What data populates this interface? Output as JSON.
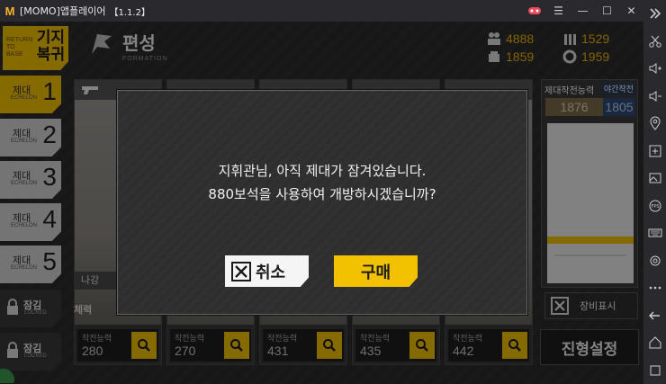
{
  "window": {
    "title": "[MOMO]앱플레이어",
    "version": "【1.1.2】",
    "controls": [
      "gamepad-icon",
      "menu-icon",
      "minimize-icon",
      "maximize-icon",
      "close-icon"
    ]
  },
  "header": {
    "back_en": "RETURN TO BASE",
    "back_ko": "기지 복귀",
    "title_ko": "편성",
    "title_en": "FORMATION"
  },
  "resources": {
    "manpower": "4888",
    "ammo": "1529",
    "rations": "1859",
    "parts": "1959"
  },
  "echelons": [
    {
      "ko": "제대",
      "en": "ECHELON",
      "num": "1"
    },
    {
      "ko": "제대",
      "en": "ECHELON",
      "num": "2"
    },
    {
      "ko": "제대",
      "en": "ECHELON",
      "num": "3"
    },
    {
      "ko": "제대",
      "en": "ECHELON",
      "num": "4"
    },
    {
      "ko": "제대",
      "en": "ECHELON",
      "num": "5"
    },
    {
      "ko": "잠김",
      "en": "LOCKED"
    },
    {
      "ko": "잠김",
      "en": "LOCKED"
    }
  ],
  "slots": [
    {
      "label": "작전능력",
      "value": "280"
    },
    {
      "label": "작전능력",
      "value": "270"
    },
    {
      "label": "작전능력",
      "value": "431"
    },
    {
      "label": "작전능력",
      "value": "435"
    },
    {
      "label": "작전능력",
      "value": "442"
    }
  ],
  "slot_extra": {
    "name": "나강",
    "hp_label": "체력"
  },
  "right_panel": {
    "label_power": "제대작전능력",
    "label_night": "야간작전",
    "power_value": "1876",
    "night_value": "1805"
  },
  "equip_toggle": {
    "label": "장비표시"
  },
  "formation_button": {
    "label": "진형설정"
  },
  "dialog": {
    "line1": "지휘관님, 아직 제대가 잠겨있습니다.",
    "line2": "880보석을 사용하여 개방하시겠습니까?",
    "cancel_label": "취소",
    "buy_label": "구매"
  },
  "colors": {
    "accent": "#f2c200",
    "dialog_bg": "#2e2e2e",
    "resource_text": "#f0b400"
  }
}
